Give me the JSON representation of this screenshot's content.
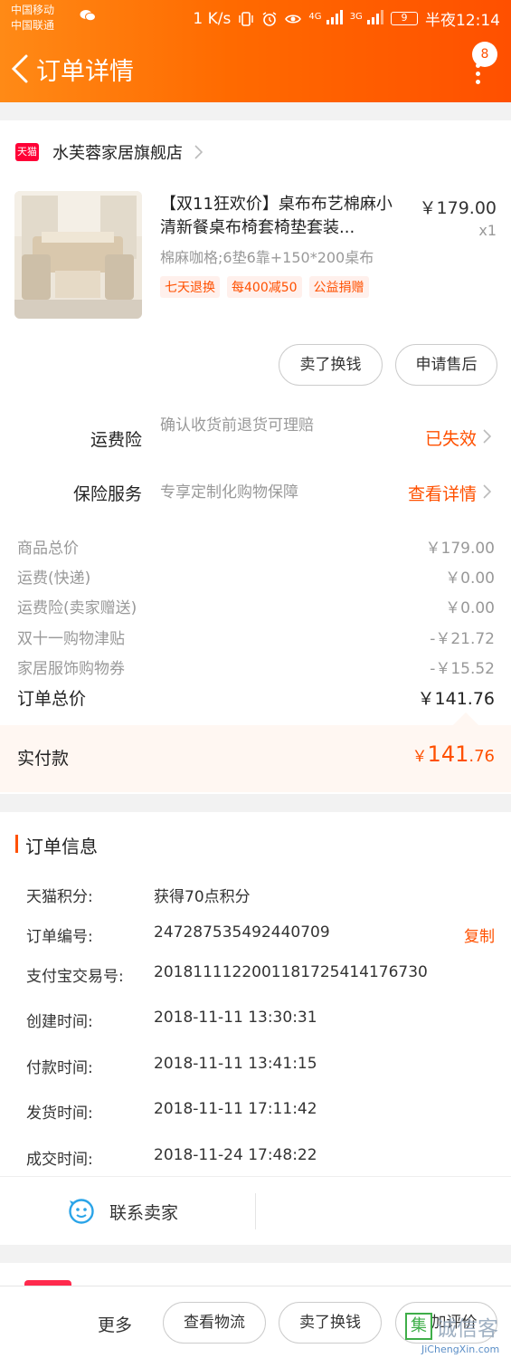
{
  "status_bar": {
    "carrier1": "中国移动",
    "carrier2": "中国联通",
    "net_speed": "1 K/s",
    "signal1": "4G",
    "signal2": "3G",
    "battery": "9",
    "time": "半夜12:14"
  },
  "nav": {
    "title": "订单详情",
    "badge": "8"
  },
  "store": {
    "badge": "天猫",
    "name": "水芙蓉家居旗舰店"
  },
  "product": {
    "title": "【双11狂欢价】桌布布艺棉麻小清新餐桌布椅套椅垫套装...",
    "sku": "棉麻咖格;6垫6靠+150*200桌布",
    "tags": [
      "七天退换",
      "每400减50",
      "公益捐赠"
    ],
    "price": "￥179.00",
    "qty": "x1"
  },
  "item_actions": {
    "sell_label": "卖了换钱",
    "aftersale_label": "申请售后"
  },
  "services": [
    {
      "label": "运费险",
      "desc": "确认收货前退货可理赔",
      "link": "已失效"
    },
    {
      "label": "保险服务",
      "desc": "专享定制化购物保障",
      "link": "查看详情"
    }
  ],
  "price_breakdown": [
    {
      "label": "商品总价",
      "value": "￥179.00"
    },
    {
      "label": "运费(快递)",
      "value": "￥0.00"
    },
    {
      "label": "运费险(卖家赠送)",
      "value": "￥0.00"
    },
    {
      "label": "双十一购物津贴",
      "value": "-￥21.72"
    },
    {
      "label": "家居服饰购物券",
      "value": "-￥15.52"
    }
  ],
  "order_total": {
    "label": "订单总价",
    "value": "￥141.76"
  },
  "paid": {
    "label": "实付款",
    "currency": "￥",
    "int": "141",
    "dec": ".76"
  },
  "order_info": {
    "title": "订单信息",
    "rows": [
      {
        "label": "天猫积分:",
        "value": "获得70点积分"
      },
      {
        "label": "订单编号:",
        "value": "247287535492440709"
      },
      {
        "label": "支付宝交易号:",
        "value": "2018111122001181725414176730"
      },
      {
        "label": "创建时间:",
        "value": "2018-11-11 13:30:31"
      },
      {
        "label": "付款时间:",
        "value": "2018-11-11 13:41:15"
      },
      {
        "label": "发货时间:",
        "value": "2018-11-11 17:11:42"
      },
      {
        "label": "成交时间:",
        "value": "2018-11-24 17:48:22"
      }
    ],
    "copy_label": "复制"
  },
  "contact": {
    "label": "联系卖家"
  },
  "bottom_bar": {
    "more": "更多",
    "logistics": "查看物流",
    "sell": "卖了换钱",
    "review": "追加评价"
  },
  "watermark": {
    "box": "集",
    "text": "诚信客",
    "url": "JiChengXin.com"
  },
  "colors": {
    "accent": "#ff5000",
    "header_start": "#ff8a16",
    "header_end": "#ff5000"
  }
}
